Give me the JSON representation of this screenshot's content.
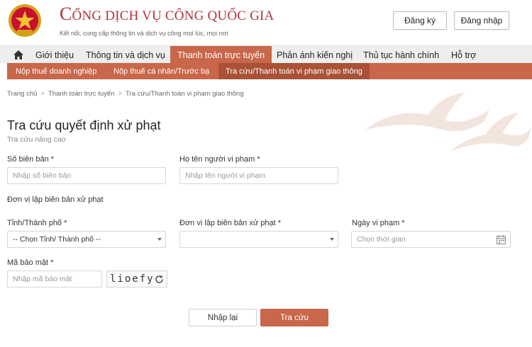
{
  "header": {
    "brand_title_initial": "C",
    "brand_title_rest": "ỔNG DỊCH VỤ CÔNG QUỐC GIA",
    "brand_subtitle": "Kết nối, cung cấp thông tin và dịch vụ công mọi lúc, mọi nơi",
    "register_label": "Đăng ký",
    "login_label": "Đăng nhập",
    "emblem_icon": "national-emblem-icon"
  },
  "nav": {
    "home_icon": "home-icon",
    "items": [
      {
        "label": "Giới thiệu"
      },
      {
        "label": "Thông tin và dịch vụ"
      },
      {
        "label": "Thanh toán trực tuyến",
        "active": true
      },
      {
        "label": "Phản ánh kiến nghị"
      },
      {
        "label": "Thủ tục hành chính"
      },
      {
        "label": "Hỗ trợ"
      }
    ]
  },
  "subnav": {
    "items": [
      {
        "label": "Nộp thuế doanh nghiệp"
      },
      {
        "label": "Nộp thuế cá nhân/Trước bạ"
      },
      {
        "label": "Tra cứu/Thanh toán vi phạm giao thông",
        "active": true
      }
    ]
  },
  "breadcrumb": {
    "sep": ">",
    "items": [
      "Trang chủ",
      "Thanh toán trực tuyến",
      "Tra cứu/Thanh toán vi phạm giao thông"
    ]
  },
  "page": {
    "title": "Tra cứu quyết định xử phạt",
    "advanced_link": "Tra cứu nâng cao"
  },
  "form": {
    "record_number": {
      "label": "Số biên bản *",
      "placeholder": "Nhập số biên bản",
      "value": ""
    },
    "violator_name": {
      "label": "Họ tên người vi phạm *",
      "placeholder": "Nhập tên người vi phạm",
      "value": ""
    },
    "section_label": "Đơn vị lập biên bản xử phạt",
    "province": {
      "label": "Tỉnh/Thành phố *",
      "selected": "-- Chọn Tỉnh/ Thành phố --"
    },
    "issuing_unit": {
      "label": "Đơn vị lập biên bản xử phạt *",
      "selected": ""
    },
    "violation_date": {
      "label": "Ngày vi phạm *",
      "placeholder": "Chọn thời gian",
      "value": ""
    },
    "captcha": {
      "label": "Mã bảo mật *",
      "placeholder": "Nhập mã bảo mật",
      "value": "",
      "code": "lioefy"
    }
  },
  "actions": {
    "reset_label": "Nhập lại",
    "search_label": "Tra cứu"
  },
  "colors": {
    "accent": "#c9674a",
    "accent_dark": "#a95237",
    "brand_red": "#b2343a"
  }
}
